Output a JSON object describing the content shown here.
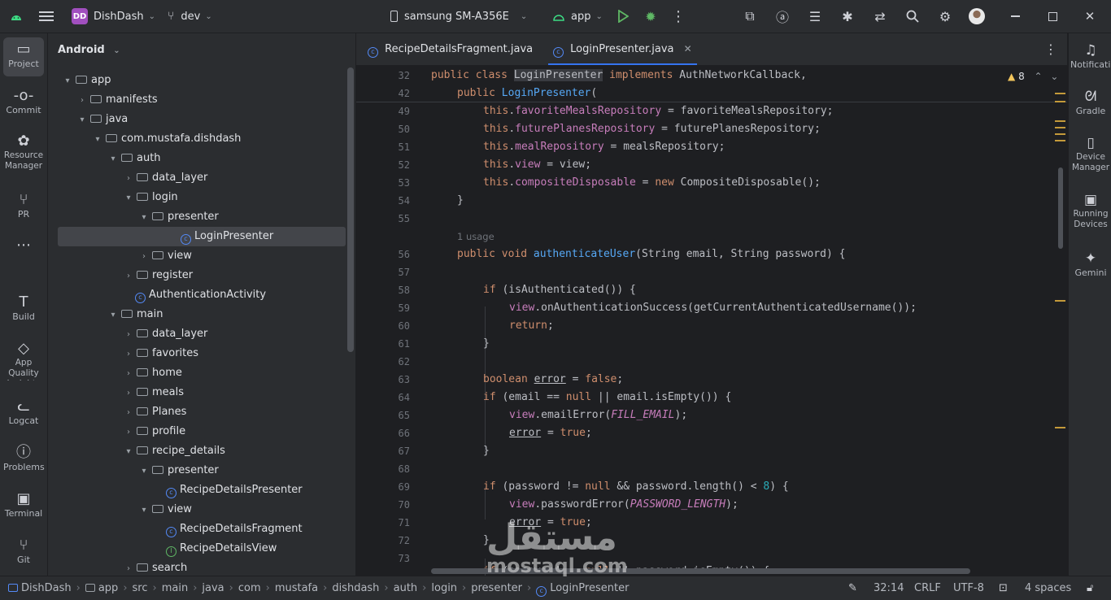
{
  "titlebar": {
    "project_badge": "DD",
    "project_name": "DishDash",
    "branch": "dev",
    "device": "samsung SM-A356E",
    "run_config": "app"
  },
  "left_tools": [
    "Project",
    "Commit",
    "Resource Manager",
    "PR",
    "Build",
    "App Quality Insights",
    "Logcat",
    "Problems",
    "Terminal",
    "Git"
  ],
  "project_panel": {
    "view_mode": "Android",
    "tree": [
      {
        "label": "app",
        "depth": 0,
        "arrow": "▾",
        "kind": "module"
      },
      {
        "label": "manifests",
        "depth": 1,
        "arrow": "›",
        "kind": "folder"
      },
      {
        "label": "java",
        "depth": 1,
        "arrow": "▾",
        "kind": "folder"
      },
      {
        "label": "com.mustafa.dishdash",
        "depth": 2,
        "arrow": "▾",
        "kind": "package"
      },
      {
        "label": "auth",
        "depth": 3,
        "arrow": "▾",
        "kind": "package"
      },
      {
        "label": "data_layer",
        "depth": 4,
        "arrow": "›",
        "kind": "package"
      },
      {
        "label": "login",
        "depth": 4,
        "arrow": "▾",
        "kind": "package"
      },
      {
        "label": "presenter",
        "depth": 5,
        "arrow": "▾",
        "kind": "package"
      },
      {
        "label": "LoginPresenter",
        "depth": 6,
        "arrow": "",
        "kind": "class",
        "selected": true
      },
      {
        "label": "view",
        "depth": 5,
        "arrow": "›",
        "kind": "package"
      },
      {
        "label": "register",
        "depth": 4,
        "arrow": "›",
        "kind": "package"
      },
      {
        "label": "AuthenticationActivity",
        "depth": 4,
        "arrow": "",
        "kind": "class"
      },
      {
        "label": "main",
        "depth": 3,
        "arrow": "▾",
        "kind": "package"
      },
      {
        "label": "data_layer",
        "depth": 4,
        "arrow": "›",
        "kind": "package"
      },
      {
        "label": "favorites",
        "depth": 4,
        "arrow": "›",
        "kind": "package"
      },
      {
        "label": "home",
        "depth": 4,
        "arrow": "›",
        "kind": "package"
      },
      {
        "label": "meals",
        "depth": 4,
        "arrow": "›",
        "kind": "package"
      },
      {
        "label": "Planes",
        "depth": 4,
        "arrow": "›",
        "kind": "package"
      },
      {
        "label": "profile",
        "depth": 4,
        "arrow": "›",
        "kind": "package"
      },
      {
        "label": "recipe_details",
        "depth": 4,
        "arrow": "▾",
        "kind": "package"
      },
      {
        "label": "presenter",
        "depth": 5,
        "arrow": "▾",
        "kind": "package"
      },
      {
        "label": "RecipeDetailsPresenter",
        "depth": 6,
        "arrow": "",
        "kind": "class"
      },
      {
        "label": "view",
        "depth": 5,
        "arrow": "▾",
        "kind": "package"
      },
      {
        "label": "RecipeDetailsFragment",
        "depth": 6,
        "arrow": "",
        "kind": "class"
      },
      {
        "label": "RecipeDetailsView",
        "depth": 6,
        "arrow": "",
        "kind": "interface"
      },
      {
        "label": "search",
        "depth": 4,
        "arrow": "›",
        "kind": "package"
      }
    ]
  },
  "editor": {
    "tabs": [
      {
        "label": "RecipeDetailsFragment.java",
        "active": false
      },
      {
        "label": "LoginPresenter.java",
        "active": true
      }
    ],
    "warnings_count": "8",
    "usage_hint": "1 usage",
    "line_numbers": [
      "32",
      "42",
      "49",
      "50",
      "51",
      "52",
      "53",
      "54",
      "55",
      "56",
      "57",
      "58",
      "59",
      "60",
      "61",
      "62",
      "63",
      "64",
      "65",
      "66",
      "67",
      "68",
      "69",
      "70",
      "71",
      "72",
      "73"
    ]
  },
  "right_tools": [
    "Notifications",
    "Gradle",
    "Device Manager",
    "Running Devices",
    "Gemini"
  ],
  "breadcrumb": [
    "DishDash",
    "app",
    "src",
    "main",
    "java",
    "com",
    "mustafa",
    "dishdash",
    "auth",
    "login",
    "presenter",
    "LoginPresenter"
  ],
  "status": {
    "position": "32:14",
    "line_sep": "CRLF",
    "encoding": "UTF-8",
    "indent": "4 spaces"
  },
  "watermark": {
    "arabic": "مستقل",
    "latin": "mostaql.com"
  },
  "colors": {
    "accent": "#3574f0",
    "keyword": "#cf8e6d",
    "field": "#c77dbb",
    "function": "#56a8f5"
  }
}
